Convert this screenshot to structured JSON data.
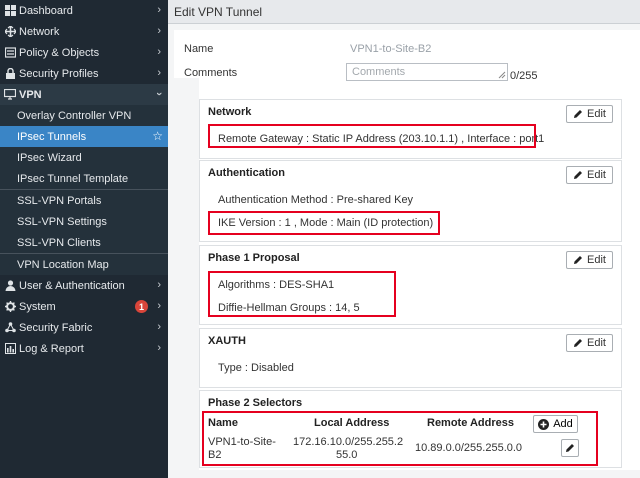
{
  "sidebar": {
    "items": [
      {
        "label": "Dashboard",
        "icon": "dashboard-icon"
      },
      {
        "label": "Network",
        "icon": "network-icon"
      },
      {
        "label": "Policy & Objects",
        "icon": "policy-icon"
      },
      {
        "label": "Security Profiles",
        "icon": "lock-icon"
      }
    ],
    "vpn": {
      "label": "VPN",
      "icon": "monitor-icon"
    },
    "vpn_sub": [
      "Overlay Controller VPN",
      "IPsec Tunnels",
      "IPsec Wizard",
      "IPsec Tunnel Template",
      "SSL-VPN Portals",
      "SSL-VPN Settings",
      "SSL-VPN Clients",
      "VPN Location Map"
    ],
    "items_after": [
      {
        "label": "User & Authentication",
        "icon": "user-icon"
      },
      {
        "label": "System",
        "icon": "gear-icon",
        "badge": "1"
      },
      {
        "label": "Security Fabric",
        "icon": "fabric-icon"
      },
      {
        "label": "Log & Report",
        "icon": "chart-icon"
      }
    ]
  },
  "header": {
    "title": "Edit VPN Tunnel"
  },
  "form": {
    "name_label": "Name",
    "name_value": "VPN1-to-Site-B2",
    "comments_label": "Comments",
    "comments_placeholder": "Comments",
    "comments_count": "0/255"
  },
  "edit_label": "Edit",
  "network": {
    "title": "Network",
    "remote_gateway": "Remote Gateway : Static IP Address (203.10.1.1) , Interface : port1"
  },
  "authentication": {
    "title": "Authentication",
    "method": "Authentication Method : Pre-shared Key",
    "ike": "IKE Version : 1 , Mode : Main (ID protection)"
  },
  "phase1": {
    "title": "Phase 1 Proposal",
    "algorithms": "Algorithms : DES-SHA1",
    "dh_groups": "Diffie-Hellman Groups : 14, 5"
  },
  "xauth": {
    "title": "XAUTH",
    "type": "Type : Disabled"
  },
  "phase2": {
    "title": "Phase 2 Selectors",
    "col_name": "Name",
    "col_local": "Local Address",
    "col_remote": "Remote Address",
    "add_label": "Add",
    "row": {
      "name_line1": "VPN1-to-Site-",
      "name_line2": "B2",
      "local_line1": "172.16.10.0/255.255.2",
      "local_line2": "55.0",
      "remote": "10.89.0.0/255.255.0.0"
    }
  },
  "colors": {
    "accent": "#3a85c6",
    "highlight": "#e5001f",
    "sidebar": "#1f2933",
    "badge": "#d9453a"
  }
}
